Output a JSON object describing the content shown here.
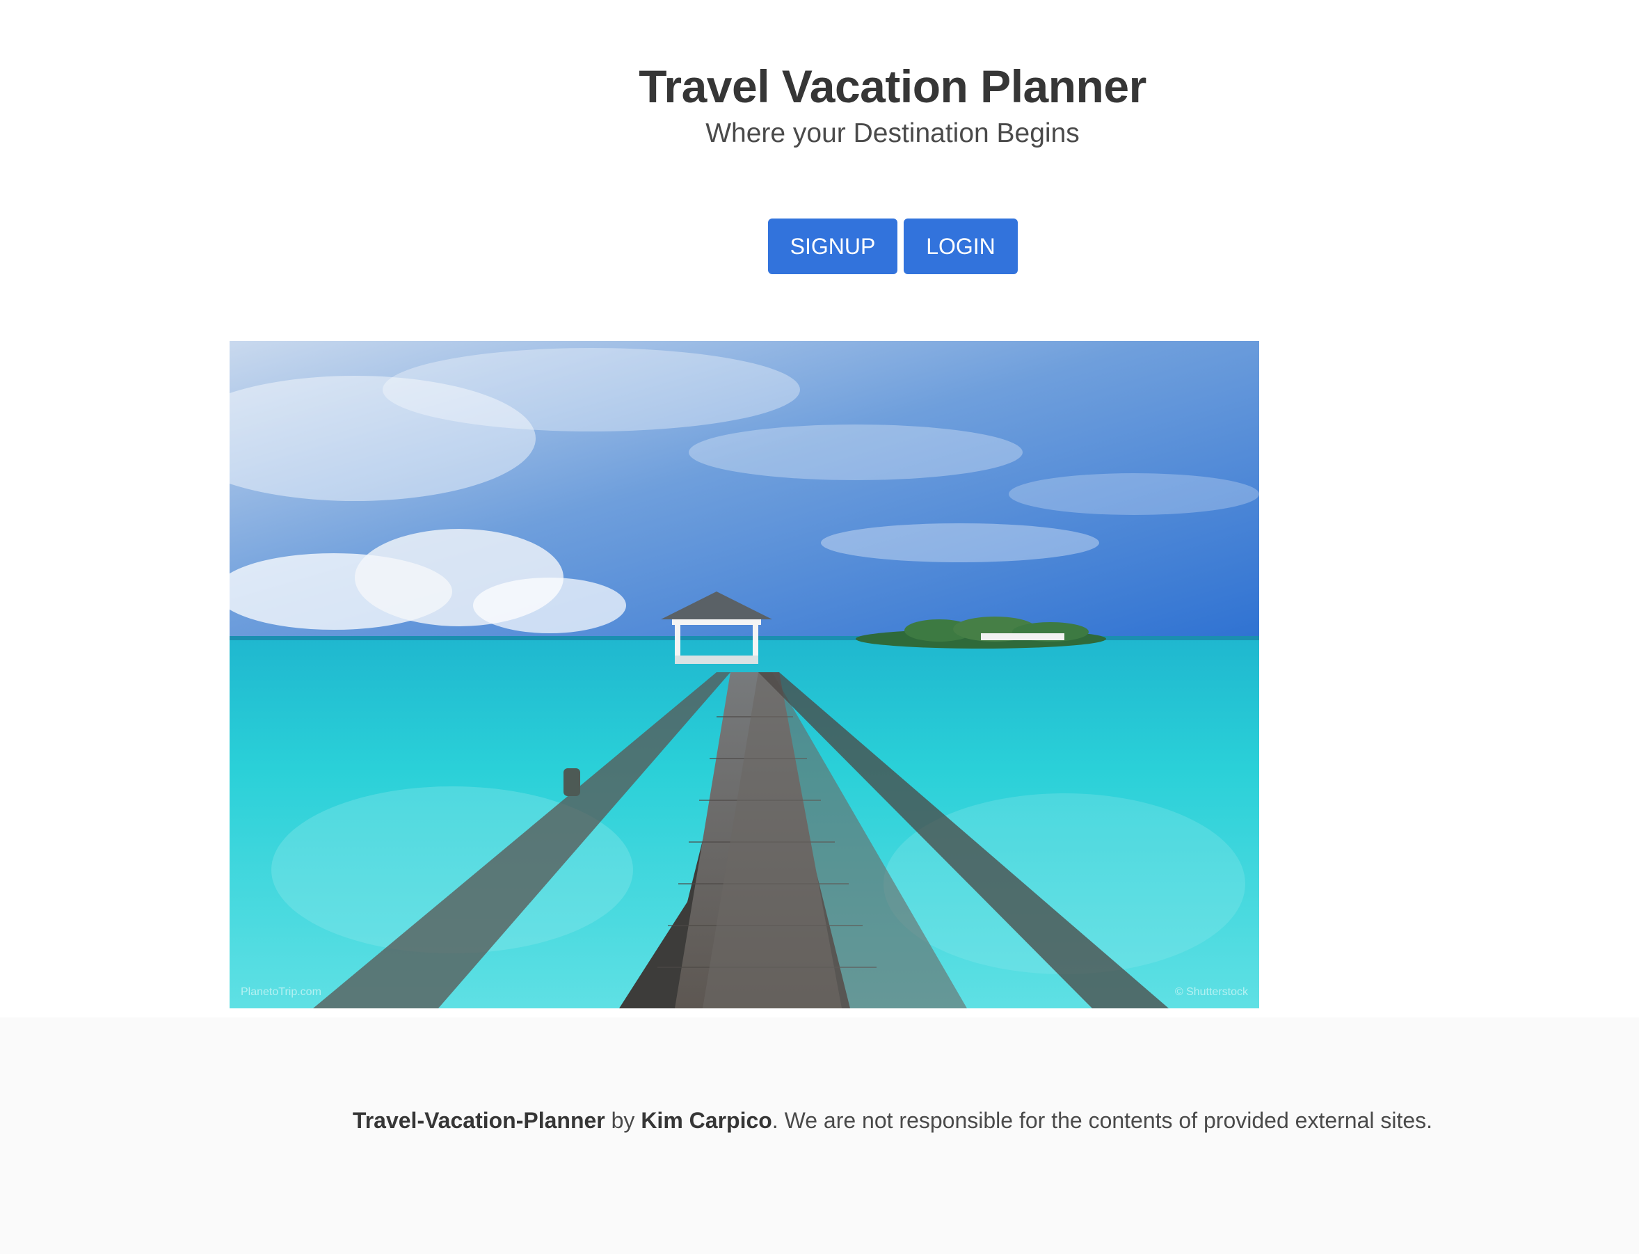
{
  "header": {
    "title": "Travel Vacation Planner",
    "subtitle": "Where your Destination Begins"
  },
  "actions": {
    "signup_label": "SIGNUP",
    "login_label": "LOGIN"
  },
  "hero_image": {
    "watermark_left": "PlanetoTrip.com",
    "watermark_right": "© Shutterstock"
  },
  "footer": {
    "project_name": "Travel-Vacation-Planner",
    "by_text": " by ",
    "author": "Kim Carpico",
    "disclaimer": ". We are not responsible for the contents of provided external sites."
  },
  "colors": {
    "primary_button": "#3273dc",
    "footer_background": "#fafafa",
    "text": "#363636"
  }
}
